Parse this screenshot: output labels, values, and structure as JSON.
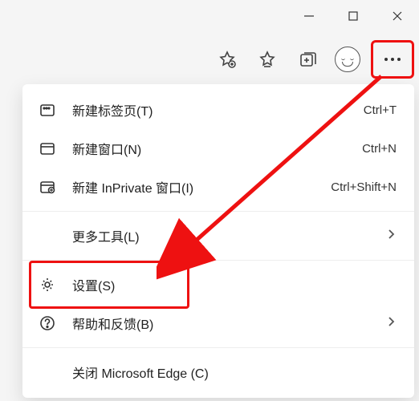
{
  "window_controls": {
    "minimize": "minimize",
    "maximize": "maximize",
    "close": "close"
  },
  "toolbar": {
    "add_favorite": "add-favorite",
    "favorites": "favorites",
    "collections": "collections",
    "profile": "profile",
    "more": "more"
  },
  "menu": {
    "new_tab": {
      "label": "新建标签页(T)",
      "shortcut": "Ctrl+T"
    },
    "new_window": {
      "label": "新建窗口(N)",
      "shortcut": "Ctrl+N"
    },
    "new_inprivate": {
      "label": "新建 InPrivate 窗口(I)",
      "shortcut": "Ctrl+Shift+N"
    },
    "more_tools": {
      "label": "更多工具(L)"
    },
    "settings": {
      "label": "设置(S)"
    },
    "help_feedback": {
      "label": "帮助和反馈(B)"
    },
    "close_edge": {
      "label": "关闭 Microsoft Edge (C)"
    }
  },
  "highlight": {
    "color": "#e11",
    "targets": [
      "more-button",
      "settings-menu-item"
    ]
  }
}
